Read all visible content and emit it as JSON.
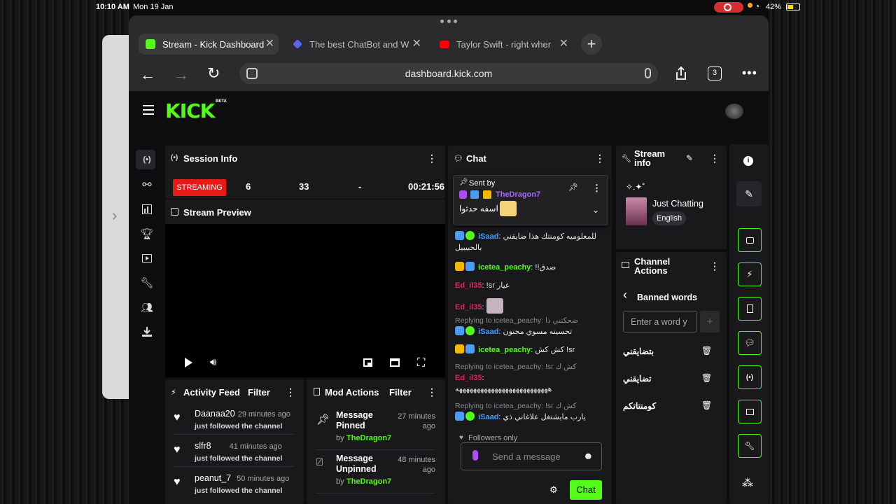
{
  "status": {
    "time": "10:10 AM",
    "date": "Mon 19 Jan",
    "battery": "42%"
  },
  "browser": {
    "tabs": [
      {
        "title": "Stream - Kick Dashboard",
        "active": true,
        "color": "#53fc18"
      },
      {
        "title": "The best ChatBot and W",
        "active": false,
        "color": "#5865f2"
      },
      {
        "title": "Taylor Swift - right wher",
        "active": false,
        "color": "#ff0000"
      }
    ],
    "url": "dashboard.kick.com",
    "tab_count": "3"
  },
  "app": {
    "logo": "KICK",
    "logo_sup": "BETA"
  },
  "session": {
    "title": "Session Info",
    "status": "STREAMING",
    "viewers": "6",
    "followers": "33",
    "subs": "-",
    "uptime": "00:21:56"
  },
  "preview": {
    "title": "Stream Preview"
  },
  "activity": {
    "title": "Activity Feed",
    "filter": "Filter",
    "items": [
      {
        "name": "Daanaa20",
        "time": "29 minutes ago",
        "text": "just followed the channel"
      },
      {
        "name": "slfr8",
        "time": "41 minutes ago",
        "text": "just followed the channel"
      },
      {
        "name": "peanut_7",
        "time": "50 minutes ago",
        "text": "just followed the channel"
      }
    ]
  },
  "mod": {
    "title": "Mod Actions",
    "filter": "Filter",
    "items": [
      {
        "action": "Message Pinned",
        "time": "27 minutes ago",
        "by": "by",
        "user": "TheDragon7"
      },
      {
        "action": "Message Unpinned",
        "time": "48 minutes ago",
        "by": "by",
        "user": "TheDragon7"
      }
    ]
  },
  "chat": {
    "title": "Chat",
    "pinned": {
      "label": "Sent by",
      "user": "TheDragon7",
      "text": "اسفه حدثوا"
    },
    "messages": [
      {
        "user": "iSaad",
        "color": "#4b9cf5",
        "text": "للمعلوميه كومنتك هذا ضايقني بالحبيبيل"
      },
      {
        "user": "icetea_peachy",
        "color": "#53fc18",
        "text": "!!صدق"
      },
      {
        "user": "Ed_il35",
        "color": "#e0245e",
        "text": "!sr عيار"
      },
      {
        "user": "Ed_il35",
        "color": "#e0245e",
        "text": ""
      },
      {
        "reply": "Replying to icetea_peachy: ضحكتني ذا",
        "user": "iSaad",
        "color": "#4b9cf5",
        "text": "تحسينه مسوي مجنون"
      },
      {
        "user": "icetea_peachy",
        "color": "#53fc18",
        "text": "كش كش !sr"
      },
      {
        "reply": "Replying to icetea_peachy: !sr كش ك",
        "user": "Ed_il35",
        "color": "#e0245e",
        "text": "ههههههههههههههههههههههههههه"
      },
      {
        "reply": "Replying to icetea_peachy: !sr كش ك",
        "user": "iSaad",
        "color": "#4b9cf5",
        "text": "يارب مايشتغل علاغاني ذي"
      }
    ],
    "mode": "Followers only",
    "input_placeholder": "Send a message",
    "send_label": "Chat"
  },
  "stream_info": {
    "title": "Stream info",
    "sparkle": "✧.✦˚",
    "category": "Just Chatting",
    "language": "English"
  },
  "channel_actions": {
    "title": "Channel Actions",
    "subtitle": "Banned words",
    "input_placeholder": "Enter a word y",
    "add": "+",
    "words": [
      "بتضايقني",
      "تضايقني",
      "كومنتاتكم"
    ]
  },
  "colors": {
    "accent": "#53fc18",
    "panel": "#19191b",
    "bg": "#0e0e10",
    "streaming": "#e91916"
  }
}
